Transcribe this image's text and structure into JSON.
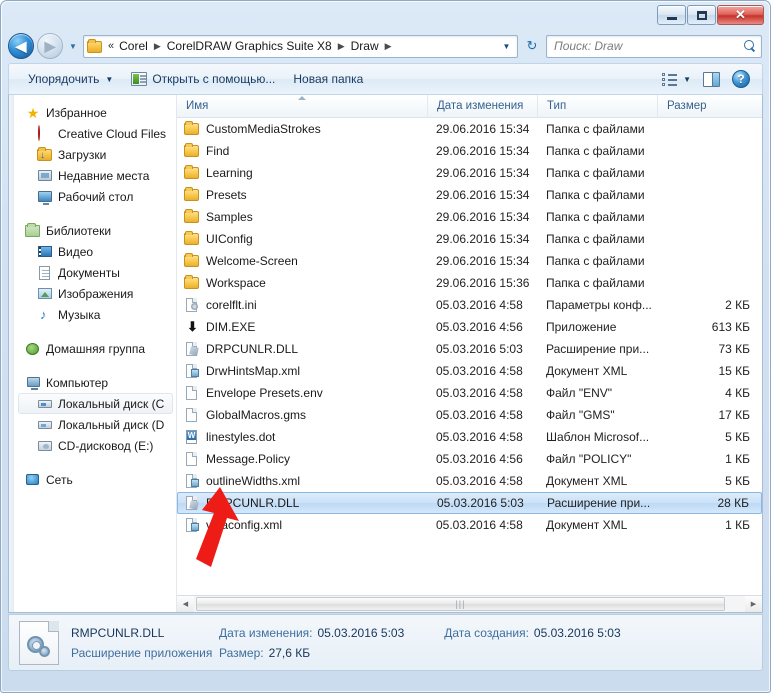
{
  "window": {
    "controls": {
      "minimize": "minimize-button",
      "maximize": "maximize-button",
      "close": "✕"
    }
  },
  "address_bar": {
    "back_glyph": "◀",
    "forward_glyph": "▶",
    "recent_caret": "▼",
    "separator": "«",
    "crumbs": [
      "Corel",
      "CorelDRAW Graphics Suite X8",
      "Draw"
    ],
    "chevron": "▶",
    "dropdown_caret": "▼",
    "refresh_glyph": "↻",
    "search_placeholder": "Поиск: Draw"
  },
  "toolbar": {
    "organize_label": "Упорядочить",
    "organize_caret": "▼",
    "open_with_label": "Открыть с помощью...",
    "new_folder_label": "Новая папка",
    "view_caret": "▼",
    "help_glyph": "?"
  },
  "sidebar": {
    "groups": [
      {
        "header": {
          "label": "Избранное",
          "icon": "star-icon"
        },
        "items": [
          {
            "label": "Creative Cloud Files",
            "icon": "creative-cloud-icon"
          },
          {
            "label": "Загрузки",
            "icon": "downloads-folder-icon"
          },
          {
            "label": "Недавние места",
            "icon": "recent-places-icon"
          },
          {
            "label": "Рабочий стол",
            "icon": "desktop-icon"
          }
        ]
      },
      {
        "header": {
          "label": "Библиотеки",
          "icon": "libraries-icon"
        },
        "items": [
          {
            "label": "Видео",
            "icon": "video-library-icon"
          },
          {
            "label": "Документы",
            "icon": "documents-library-icon"
          },
          {
            "label": "Изображения",
            "icon": "pictures-library-icon"
          },
          {
            "label": "Музыка",
            "icon": "music-library-icon"
          }
        ]
      },
      {
        "header": {
          "label": "Домашняя группа",
          "icon": "homegroup-icon"
        },
        "items": []
      },
      {
        "header": {
          "label": "Компьютер",
          "icon": "computer-icon"
        },
        "items": [
          {
            "label": "Локальный диск (C",
            "icon": "local-disk-icon",
            "selected": true
          },
          {
            "label": "Локальный диск (D",
            "icon": "local-disk-icon"
          },
          {
            "label": "CD-дисковод (E:)",
            "icon": "cd-drive-icon"
          }
        ]
      },
      {
        "header": {
          "label": "Сеть",
          "icon": "network-icon"
        },
        "items": []
      }
    ]
  },
  "file_list": {
    "columns": {
      "name": "Имя",
      "date_modified": "Дата изменения",
      "type": "Тип",
      "size": "Размер"
    },
    "sort_column": "name",
    "rows": [
      {
        "name": "CustomMediaStrokes",
        "date": "29.06.2016 15:34",
        "type": "Папка с файлами",
        "size": "",
        "icon": "folder-icon"
      },
      {
        "name": "Find",
        "date": "29.06.2016 15:34",
        "type": "Папка с файлами",
        "size": "",
        "icon": "folder-icon"
      },
      {
        "name": "Learning",
        "date": "29.06.2016 15:34",
        "type": "Папка с файлами",
        "size": "",
        "icon": "folder-icon"
      },
      {
        "name": "Presets",
        "date": "29.06.2016 15:34",
        "type": "Папка с файлами",
        "size": "",
        "icon": "folder-icon"
      },
      {
        "name": "Samples",
        "date": "29.06.2016 15:34",
        "type": "Папка с файлами",
        "size": "",
        "icon": "folder-icon"
      },
      {
        "name": "UIConfig",
        "date": "29.06.2016 15:34",
        "type": "Папка с файлами",
        "size": "",
        "icon": "folder-icon"
      },
      {
        "name": "Welcome-Screen",
        "date": "29.06.2016 15:34",
        "type": "Папка с файлами",
        "size": "",
        "icon": "folder-icon"
      },
      {
        "name": "Workspace",
        "date": "29.06.2016 15:36",
        "type": "Папка с файлами",
        "size": "",
        "icon": "folder-icon"
      },
      {
        "name": "corelflt.ini",
        "date": "05.03.2016 4:58",
        "type": "Параметры конф...",
        "size": "2 КБ",
        "icon": "ini-file-icon"
      },
      {
        "name": "DIM.EXE",
        "date": "05.03.2016 4:56",
        "type": "Приложение",
        "size": "613 КБ",
        "icon": "exe-file-icon"
      },
      {
        "name": "DRPCUNLR.DLL",
        "date": "05.03.2016 5:03",
        "type": "Расширение при...",
        "size": "73 КБ",
        "icon": "dll-file-icon"
      },
      {
        "name": "DrwHintsMap.xml",
        "date": "05.03.2016 4:58",
        "type": "Документ XML",
        "size": "15 КБ",
        "icon": "xml-file-icon"
      },
      {
        "name": "Envelope Presets.env",
        "date": "05.03.2016 4:58",
        "type": "Файл \"ENV\"",
        "size": "4 КБ",
        "icon": "generic-file-icon"
      },
      {
        "name": "GlobalMacros.gms",
        "date": "05.03.2016 4:58",
        "type": "Файл \"GMS\"",
        "size": "17 КБ",
        "icon": "generic-file-icon"
      },
      {
        "name": "linestyles.dot",
        "date": "05.03.2016 4:58",
        "type": "Шаблон Microsof...",
        "size": "5 КБ",
        "icon": "word-template-icon"
      },
      {
        "name": "Message.Policy",
        "date": "05.03.2016 4:56",
        "type": "Файл \"POLICY\"",
        "size": "1 КБ",
        "icon": "generic-file-icon"
      },
      {
        "name": "outlineWidths.xml",
        "date": "05.03.2016 4:58",
        "type": "Документ XML",
        "size": "5 КБ",
        "icon": "xml-file-icon"
      },
      {
        "name": "RMPCUNLR.DLL",
        "date": "05.03.2016 5:03",
        "type": "Расширение при...",
        "size": "28 КБ",
        "icon": "dll-file-icon",
        "selected": true
      },
      {
        "name": "vstaconfig.xml",
        "date": "05.03.2016 4:58",
        "type": "Документ XML",
        "size": "1 КБ",
        "icon": "xml-file-icon"
      }
    ]
  },
  "scrollbar": {
    "left_glyph": "◀",
    "right_glyph": "▶",
    "grip": "|||"
  },
  "details_pane": {
    "file_name": "RMPCUNLR.DLL",
    "file_kind": "Расширение приложения",
    "modified_label": "Дата изменения:",
    "modified_value": "05.03.2016 5:03",
    "created_label": "Дата создания:",
    "created_value": "05.03.2016 5:03",
    "size_label": "Размер:",
    "size_value": "27,6 КБ",
    "icon": "dll-file-large-icon"
  },
  "annotation": {
    "arrow_color": "#ee1c17",
    "points_to": "RMPCUNLR.DLL"
  }
}
